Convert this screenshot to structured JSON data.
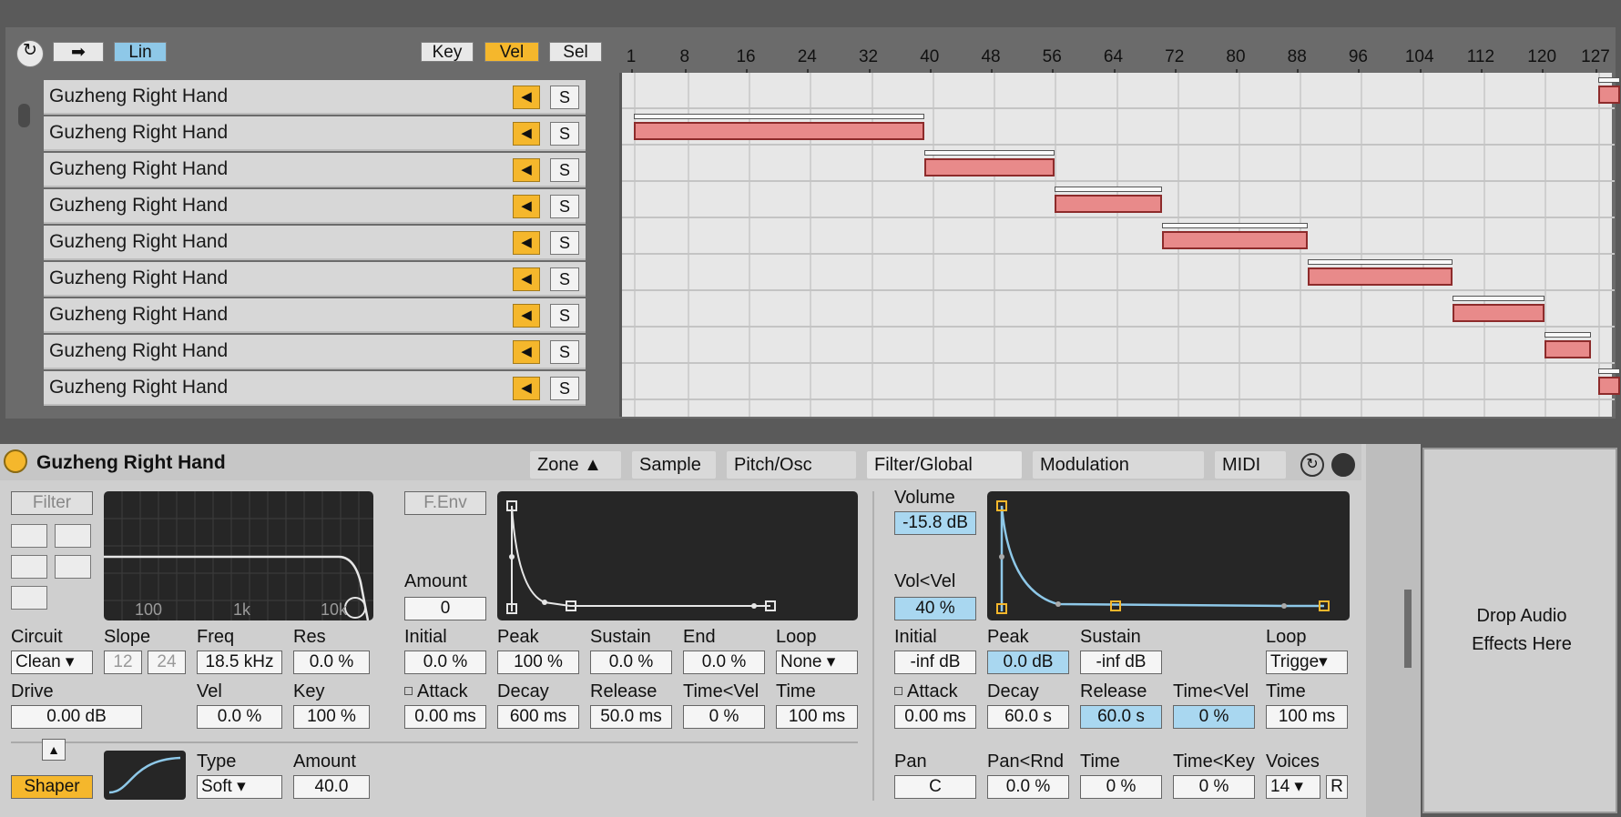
{
  "toolbar": {
    "lin_label": "Lin",
    "key_label": "Key",
    "vel_label": "Vel",
    "sel_label": "Sel"
  },
  "ruler": [
    "1",
    "8",
    "16",
    "24",
    "32",
    "40",
    "48",
    "56",
    "64",
    "72",
    "80",
    "88",
    "96",
    "104",
    "112",
    "120",
    "127"
  ],
  "zones": [
    {
      "name": "Guzheng Right Hand",
      "solo": "S"
    },
    {
      "name": "Guzheng Right Hand",
      "solo": "S"
    },
    {
      "name": "Guzheng Right Hand",
      "solo": "S"
    },
    {
      "name": "Guzheng Right Hand",
      "solo": "S"
    },
    {
      "name": "Guzheng Right Hand",
      "solo": "S"
    },
    {
      "name": "Guzheng Right Hand",
      "solo": "S"
    },
    {
      "name": "Guzheng Right Hand",
      "solo": "S"
    },
    {
      "name": "Guzheng Right Hand",
      "solo": "S"
    },
    {
      "name": "Guzheng Right Hand",
      "solo": "S"
    }
  ],
  "velocity_ranges": [
    {
      "start": 127,
      "end": 127
    },
    {
      "start": 1,
      "end": 38
    },
    {
      "start": 39,
      "end": 55
    },
    {
      "start": 56,
      "end": 69
    },
    {
      "start": 70,
      "end": 88
    },
    {
      "start": 89,
      "end": 107
    },
    {
      "start": 108,
      "end": 119
    },
    {
      "start": 120,
      "end": 125
    },
    {
      "start": 127,
      "end": 127
    }
  ],
  "device": {
    "title": "Guzheng Right Hand",
    "tabs": [
      "Zone ▲",
      "Sample",
      "Pitch/Osc",
      "Filter/Global",
      "Modulation",
      "MIDI"
    ]
  },
  "filter": {
    "filter_label": "Filter",
    "freq_axis": [
      "100",
      "1k",
      "10k"
    ],
    "circuit_label": "Circuit",
    "circuit_value": "Clean ▾",
    "slope_label": "Slope",
    "slope_12": "12",
    "slope_24": "24",
    "freq_label": "Freq",
    "freq_value": "18.5 kHz",
    "res_label": "Res",
    "res_value": "0.0 %",
    "drive_label": "Drive",
    "drive_value": "0.00 dB",
    "vel_label": "Vel",
    "vel_value": "0.0 %",
    "key_label": "Key",
    "key_value": "100 %",
    "shaper_label": "Shaper",
    "type_label": "Type",
    "type_value": "Soft ▾",
    "amount_label": "Amount",
    "amount_value": "40.0"
  },
  "fenv": {
    "fenv_label": "F.Env",
    "amount_label": "Amount",
    "amount_value": "0",
    "initial_label": "Initial",
    "initial_value": "0.0 %",
    "peak_label": "Peak",
    "peak_value": "100 %",
    "sustain_label": "Sustain",
    "sustain_value": "0.0 %",
    "end_label": "End",
    "end_value": "0.0 %",
    "loop_label": "Loop",
    "loop_value": "None ▾",
    "attack_label": "Attack",
    "attack_value": "0.00 ms",
    "decay_label": "Decay",
    "decay_value": "600 ms",
    "release_label": "Release",
    "release_value": "50.0 ms",
    "timevel_label": "Time<Vel",
    "timevel_value": "0 %",
    "time_label": "Time",
    "time_value": "100 ms"
  },
  "amp": {
    "volume_label": "Volume",
    "volume_value": "-15.8 dB",
    "volvel_label": "Vol<Vel",
    "volvel_value": "40 %",
    "initial_label": "Initial",
    "initial_value": "-inf dB",
    "peak_label": "Peak",
    "peak_value": "0.0 dB",
    "sustain_label": "Sustain",
    "sustain_value": "-inf dB",
    "loop_label": "Loop",
    "loop_value": "Trigge▾",
    "attack_label": "Attack",
    "attack_value": "0.00 ms",
    "decay_label": "Decay",
    "decay_value": "60.0 s",
    "release_label": "Release",
    "release_value": "60.0 s",
    "timevel_label": "Time<Vel",
    "timevel_value": "0 %",
    "time_label": "Time",
    "time_value": "100 ms",
    "pan_label": "Pan",
    "pan_value": "C",
    "panrnd_label": "Pan<Rnd",
    "panrnd_value": "0.0 %",
    "time2_label": "Time",
    "time2_value": "0 %",
    "timekey_label": "Time<Key",
    "timekey_value": "0 %",
    "voices_label": "Voices",
    "voices_value": "14 ▾",
    "retrig_label": "R"
  },
  "effects": {
    "line1": "Drop Audio",
    "line2": "Effects Here"
  },
  "colors": {
    "accent_orange": "#f5b72c",
    "accent_blue": "#8ec8e8",
    "zone_fill": "#e88a8a",
    "zone_border": "#8d2b2b"
  }
}
